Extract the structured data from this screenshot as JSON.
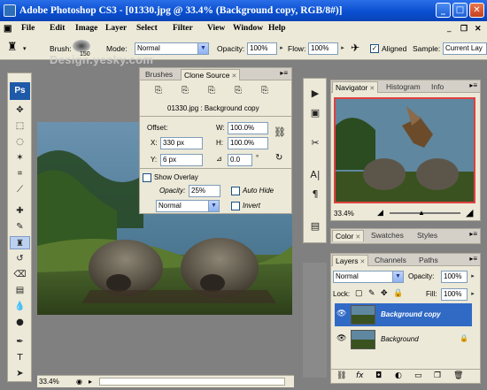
{
  "window": {
    "title": "Adobe Photoshop CS3 - [01330.jpg @ 33.4% (Background copy, RGB/8#)]"
  },
  "menu": [
    "File",
    "Edit",
    "Image",
    "Layer",
    "Select",
    "Filter",
    "View",
    "Window",
    "Help"
  ],
  "options": {
    "brush_label": "Brush:",
    "brush_size": "150",
    "mode_label": "Mode:",
    "mode_value": "Normal",
    "opacity_label": "Opacity:",
    "opacity_value": "100%",
    "flow_label": "Flow:",
    "flow_value": "100%",
    "aligned_label": "Aligned",
    "sample_label": "Sample:",
    "sample_value": "Current Lay"
  },
  "watermark": "Design.yesky.com",
  "clone_source": {
    "tabs": [
      "Brushes",
      "Clone Source"
    ],
    "file_label": "01330.jpg : Background copy",
    "offset_label": "Offset:",
    "x_label": "X:",
    "x_value": "330 px",
    "y_label": "Y:",
    "y_value": "6 px",
    "w_label": "W:",
    "w_value": "100.0%",
    "h_label": "H:",
    "h_value": "100.0%",
    "angle_value": "0.0",
    "degree_symbol": "°",
    "show_overlay_label": "Show Overlay",
    "opacity_label": "Opacity:",
    "opacity_value": "25%",
    "auto_hide_label": "Auto Hide",
    "blend_value": "Normal",
    "invert_label": "Invert"
  },
  "navigator": {
    "tabs": [
      "Navigator",
      "Histogram",
      "Info"
    ],
    "zoom": "33.4%",
    "zoom_slider": 0.45
  },
  "color_panel": {
    "tabs": [
      "Color",
      "Swatches",
      "Styles"
    ]
  },
  "layers": {
    "tabs": [
      "Layers",
      "Channels",
      "Paths"
    ],
    "blend_mode": "Normal",
    "opacity_label": "Opacity:",
    "opacity_value": "100%",
    "lock_label": "Lock:",
    "fill_label": "Fill:",
    "fill_value": "100%",
    "items": [
      {
        "name": "Background copy"
      },
      {
        "name": "Background"
      }
    ]
  },
  "status": {
    "zoom": "33.4%"
  }
}
